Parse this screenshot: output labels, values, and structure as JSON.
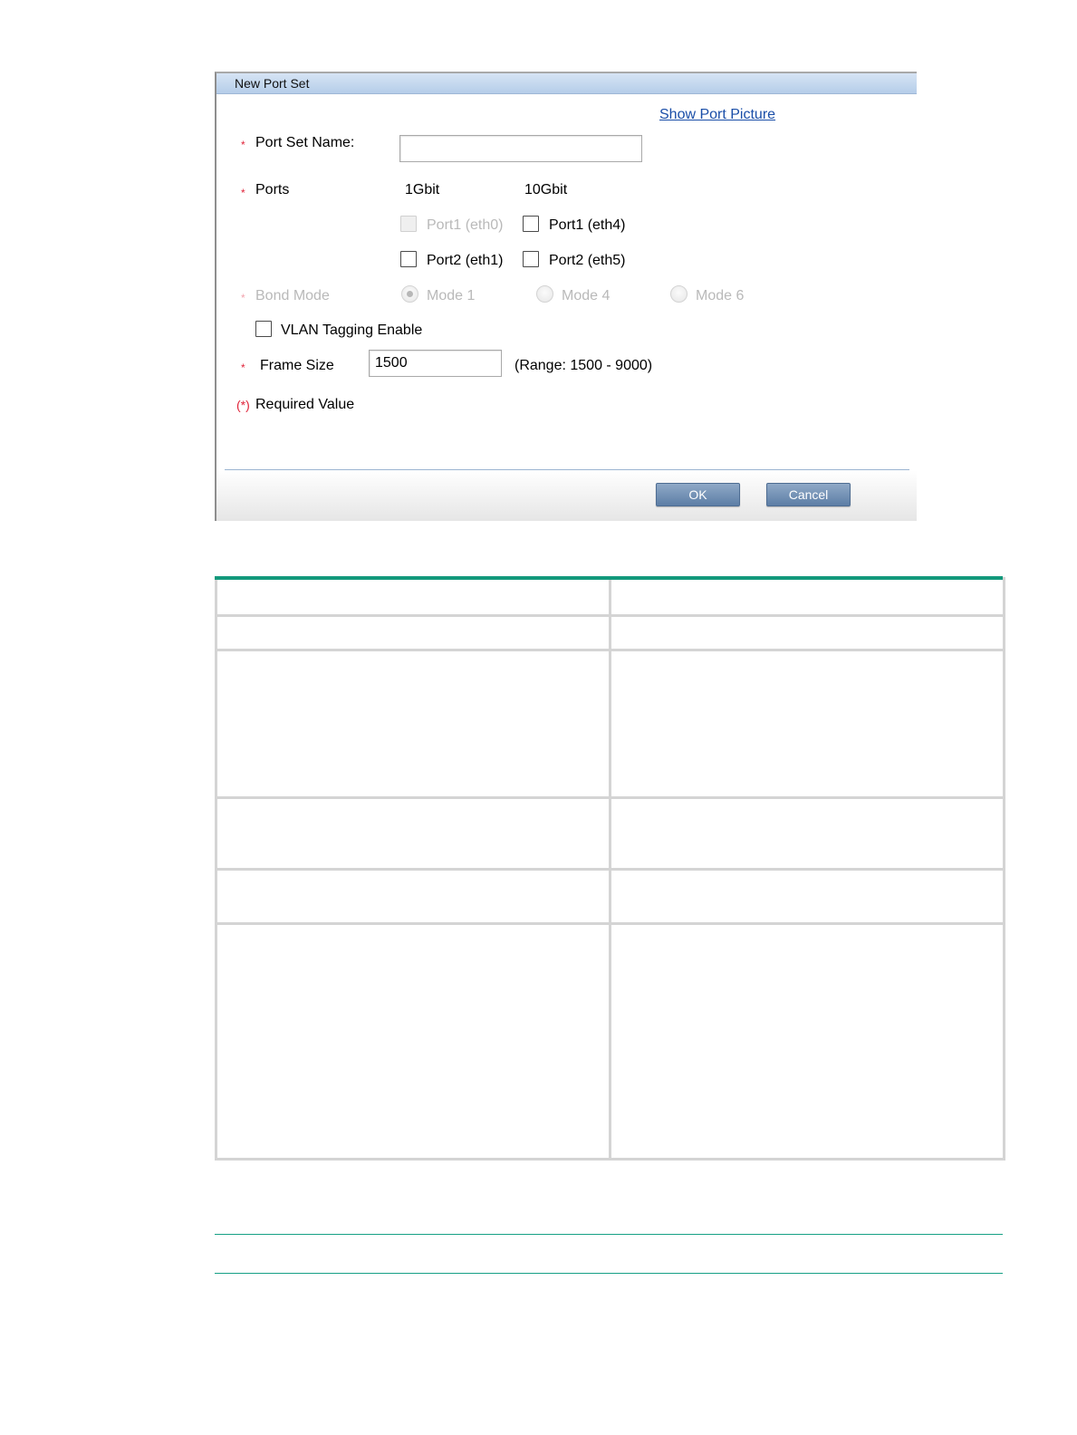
{
  "dialog": {
    "title": "New Port Set",
    "show_port_picture": "Show Port Picture",
    "required_mark": "*",
    "port_set_name_label": "Port Set Name:",
    "port_set_name_value": "",
    "ports_label": "Ports",
    "col_1gbit": "1Gbit",
    "col_10gbit": "10Gbit",
    "ports": {
      "p1_eth0": "Port1 (eth0)",
      "p1_eth4": "Port1 (eth4)",
      "p2_eth1": "Port2 (eth1)",
      "p2_eth5": "Port2 (eth5)"
    },
    "bond_mode_label": "Bond Mode",
    "modes": [
      "Mode 1",
      "Mode 4",
      "Mode 6"
    ],
    "vlan_label": "VLAN Tagging Enable",
    "frame_size_label": "Frame Size",
    "frame_size_value": "1500",
    "frame_size_range": "(Range: 1500 - 9000)",
    "required_note_mark": "(*)",
    "required_note": "Required Value",
    "ok_label": "OK",
    "cancel_label": "Cancel"
  },
  "colors": {
    "title_bar": "#c3d7ee",
    "required": "#e0243a",
    "link": "#1a4ea8",
    "button": "#6f8db3",
    "table_rule": "#13997c"
  }
}
